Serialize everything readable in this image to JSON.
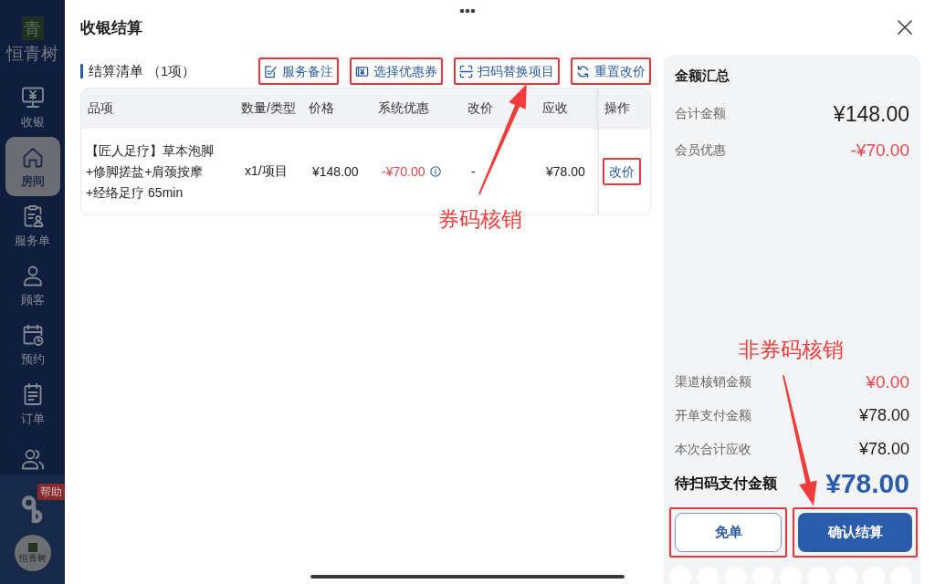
{
  "sidebar": {
    "logo": {
      "mark": "青",
      "name": "恒青树"
    },
    "items": [
      {
        "label": "收银",
        "selected": false
      },
      {
        "label": "房间",
        "selected": true
      },
      {
        "label": "服务单",
        "selected": false
      },
      {
        "label": "顾客",
        "selected": false
      },
      {
        "label": "预约",
        "selected": false
      },
      {
        "label": "订单",
        "selected": false
      },
      {
        "selected": false
      }
    ],
    "help_badge": "帮助",
    "account": {
      "name": "恒青树"
    }
  },
  "dialog": {
    "title": "收银结算"
  },
  "settlement_list": {
    "title": "结算清单",
    "count": "（1项）",
    "actions": [
      {
        "label": "服务备注",
        "highlighted": true
      },
      {
        "label": "选择优惠券",
        "highlighted": true
      },
      {
        "label": "扫码替换项目",
        "highlighted": true
      },
      {
        "label": "重置改价",
        "highlighted": true
      }
    ]
  },
  "table": {
    "columns": [
      "品项",
      "数量/类型",
      "价格",
      "系统优惠",
      "改价",
      "应收",
      "操作"
    ],
    "rows": [
      {
        "item": "【匠人足疗】草本泡脚+修脚搓盐+肩颈按摩+经络足疗 65min",
        "quantity": "x1/项目",
        "price": "¥148.00",
        "system_discount": "-¥70.00",
        "price_change": "-",
        "receivable": "¥78.00",
        "action": {
          "label": "改价",
          "highlighted": true
        }
      }
    ]
  },
  "summary": {
    "title": "金额汇总",
    "rows": [
      {
        "label": "合计金额",
        "value": "¥148.00",
        "kind": "total"
      },
      {
        "label": "会员优惠",
        "value": "-¥70.00",
        "kind": "discount"
      }
    ],
    "settlement_rows": [
      {
        "label": "渠道核销金额",
        "value": "¥0.00",
        "kind": "discount"
      },
      {
        "label": "开单支付金额",
        "value": "¥78.00",
        "kind": "amount"
      },
      {
        "label": "本次合计应收",
        "value": "¥78.00",
        "kind": "amount"
      }
    ],
    "due": {
      "label": "待扫码支付金额",
      "value": "¥78.00"
    },
    "buttons": [
      {
        "label": "免单",
        "kind": "secondary",
        "highlighted": true
      },
      {
        "label": "确认结算",
        "kind": "primary",
        "highlighted": true
      }
    ]
  },
  "annotations": [
    {
      "text": "券码核销"
    },
    {
      "text": "非券码核销"
    }
  ]
}
